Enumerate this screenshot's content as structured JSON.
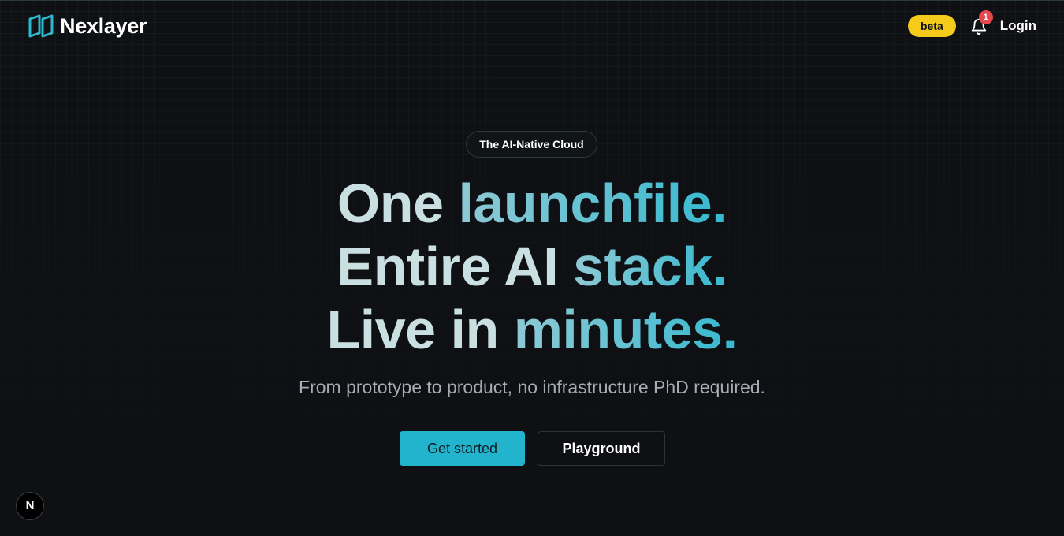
{
  "brand": {
    "name": "Nexlayer",
    "logo_icon": "nexlayer-logo-icon",
    "accent_color": "#22b4cc"
  },
  "header": {
    "beta_label": "beta",
    "beta_color": "#f5cb1b",
    "notification_icon": "bell-icon",
    "notification_count": "1",
    "login_label": "Login"
  },
  "hero": {
    "tagline": "The AI-Native Cloud",
    "headline": {
      "line1": {
        "w1": "One",
        "w2": "launchfile."
      },
      "line2": {
        "w1": "Entire",
        "w2": "AI",
        "w3": "stack."
      },
      "line3": {
        "w1": "Live",
        "w2": "in",
        "w3": "minutes."
      }
    },
    "subhead": "From prototype to product, no infrastructure PhD required.",
    "primary_cta": "Get started",
    "secondary_cta": "Playground"
  },
  "dev_tools": {
    "label": "N",
    "icon": "nextjs-devtools-icon"
  }
}
